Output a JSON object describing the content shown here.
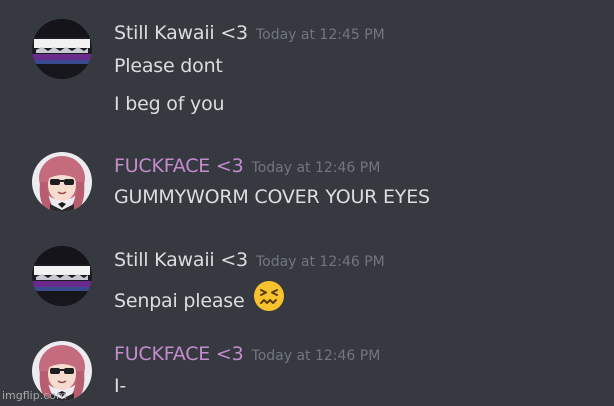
{
  "messages": [
    {
      "author": "Still Kawaii <3",
      "author_color": "#dcddde",
      "timestamp": "Today at 12:45 PM",
      "avatar_icon": "band-logo-avatar",
      "lines": [
        "Please dont",
        "I beg of you"
      ]
    },
    {
      "author": "FUCKFACE <3",
      "author_color": "#c58ccf",
      "timestamp": "Today at 12:46 PM",
      "avatar_icon": "anime-character-avatar",
      "lines": [
        "GUMMYWORM COVER YOUR EYES"
      ]
    },
    {
      "author": "Still Kawaii <3",
      "author_color": "#dcddde",
      "timestamp": "Today at 12:46 PM",
      "avatar_icon": "band-logo-avatar",
      "lines": [
        "Senpai please"
      ],
      "emoji": "confounded-face-emoji"
    },
    {
      "author": "FUCKFACE <3",
      "author_color": "#c58ccf",
      "timestamp": "Today at 12:46 PM",
      "avatar_icon": "anime-character-avatar",
      "lines": [
        "I-"
      ]
    }
  ],
  "watermark": "imgflip.com"
}
